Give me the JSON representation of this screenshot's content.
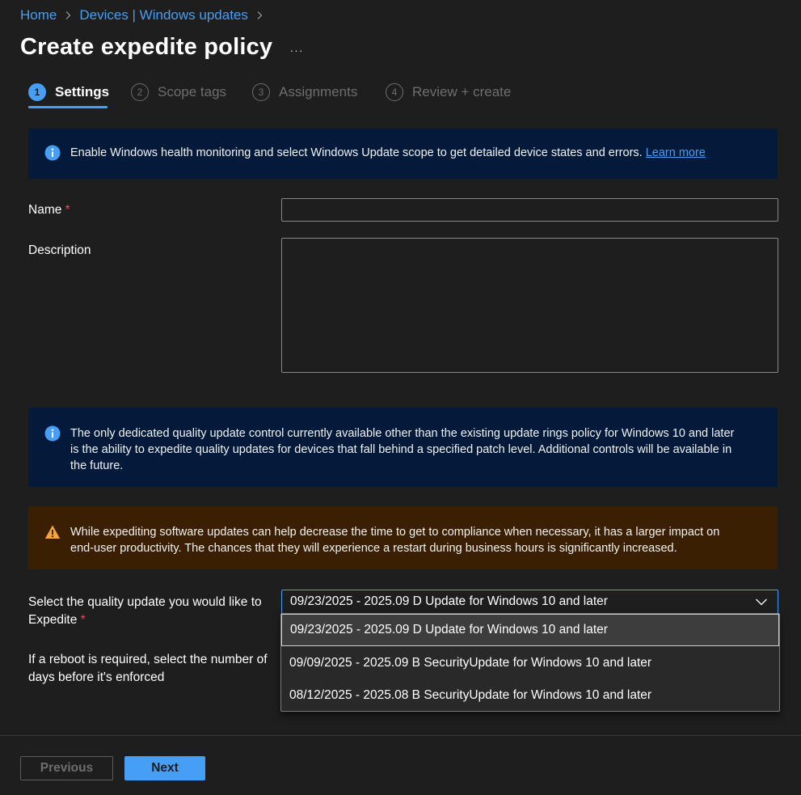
{
  "breadcrumb": {
    "home": "Home",
    "devices": "Devices | Windows updates"
  },
  "page": {
    "title": "Create expedite policy",
    "more": "···"
  },
  "tabs": [
    {
      "num": "1",
      "label": "Settings",
      "active": true
    },
    {
      "num": "2",
      "label": "Scope tags",
      "active": false
    },
    {
      "num": "3",
      "label": "Assignments",
      "active": false
    },
    {
      "num": "4",
      "label": "Review + create",
      "active": false
    }
  ],
  "banner_health": {
    "text": "Enable Windows health monitoring and select Windows Update scope to get detailed device states and errors.",
    "link": "Learn more"
  },
  "form": {
    "name_label": "Name",
    "required_mark": "*",
    "name_value": "",
    "description_label": "Description",
    "description_value": ""
  },
  "banner_quality": {
    "text": "The only dedicated quality update control currently available other than the existing update rings policy for Windows 10 and later is the ability to expedite quality updates for devices that fall behind a specified patch level. Additional controls will be available in the future."
  },
  "banner_warning": {
    "text": "While expediting software updates can help decrease the time to get to compliance when necessary, it has a larger impact on end-user productivity. The chances that they will experience a restart during business hours is significantly increased."
  },
  "quality_update": {
    "label": "Select the quality update you would like to Expedite",
    "selected": "09/23/2025 - 2025.09 D Update for Windows 10 and later",
    "options": [
      "09/23/2025 - 2025.09 D Update for Windows 10 and later",
      "09/09/2025 - 2025.09 B SecurityUpdate for Windows 10 and later",
      "08/12/2025 - 2025.08 B SecurityUpdate for Windows 10 and later"
    ]
  },
  "reboot": {
    "label": "If a reboot is required, select the number of days before it's enforced"
  },
  "footer": {
    "previous": "Previous",
    "next": "Next"
  },
  "colors": {
    "background": "#1f1e1e",
    "accent": "#479ef5",
    "info_bar": "#031a3b",
    "warning_bar": "#3a1f02",
    "warning_icon": "#f7a43a",
    "required": "#e74c4c"
  }
}
